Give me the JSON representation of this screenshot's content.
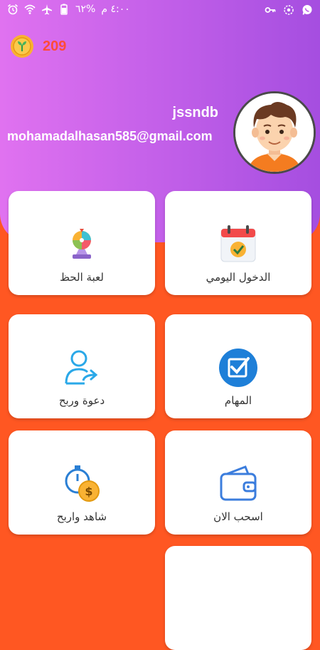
{
  "status_bar": {
    "time": "٤:٠٠ م",
    "battery": "%٦٢"
  },
  "header": {
    "coins": "209",
    "username": "jssndb",
    "email": "mohamadalhasan585@gmail.com"
  },
  "cards": [
    {
      "label": "الدخول اليومي",
      "icon": "calendar-check-icon"
    },
    {
      "label": "لعبة الحظ",
      "icon": "lucky-wheel-icon"
    },
    {
      "label": "المهام",
      "icon": "checkbox-icon"
    },
    {
      "label": "دعوة وربح",
      "icon": "invite-user-icon"
    },
    {
      "label": "اسحب الان",
      "icon": "wallet-icon"
    },
    {
      "label": "شاهد واربح",
      "icon": "stopwatch-coin-icon"
    }
  ],
  "colors": {
    "header_gradient_start": "#e072f0",
    "header_gradient_end": "#a54ee0",
    "background": "#ff5722",
    "coin_count": "#ff4b3a"
  }
}
